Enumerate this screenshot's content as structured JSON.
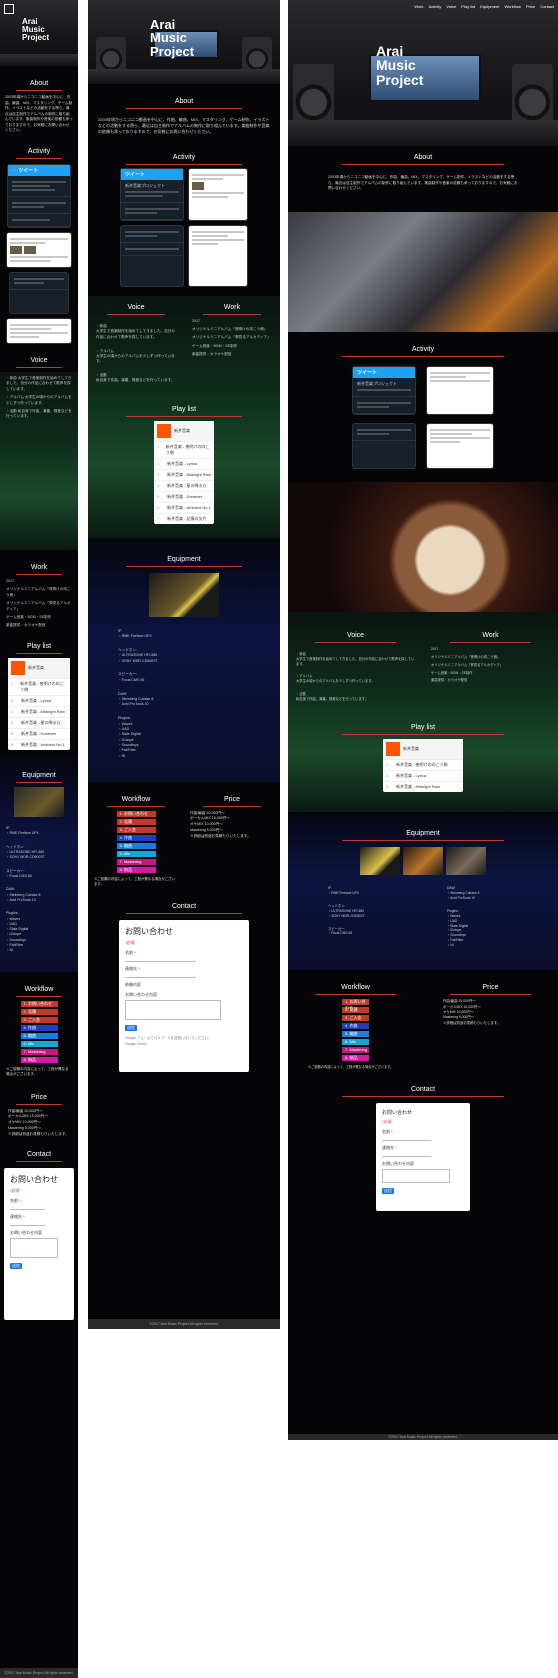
{
  "site": {
    "title_line1": "Arai",
    "title_line2": "Music",
    "title_line3": "Project",
    "nav": [
      "Work",
      "Activity",
      "Voice",
      "Play list",
      "Equipment",
      "Workflow",
      "Price",
      "Contact"
    ]
  },
  "sections": {
    "about": "About",
    "activity": "Activity",
    "voice": "Voice",
    "work": "Work",
    "playlist": "Play list",
    "equipment": "Equipment",
    "workflow": "Workflow",
    "price": "Price",
    "contact": "Contact"
  },
  "about_text": "2003年頃からニコニコ動画を中心に、作曲、編曲、MIX、マスタリング、ゲーム制作、イラストなどの活動をする傍ら、最近は自主制作でアルバムの制作に取り組んでいます。楽曲制作や音楽の依頼も承っておりますので、お気軽にお問い合わせください。",
  "activity": {
    "tweet_header": "ツイート",
    "tweet_user": "新井音楽プロジェクト",
    "tweet1": "新曲のデモを公開しました。今回はアンビエント寄りのトラックです。",
    "tweet2": "ミキシング作業中。週末には完成予定です。",
    "fb_title": "Arai Music Project"
  },
  "voice": [
    "・新曲\n大学生で音楽制作を始めてしてきました。自分の作品に合わせて歌声を探しています。",
    "・アルバム\n大学生の頃からのアルバムを少しずつ作っています。",
    "・活動\n私自身で作曲、演奏、録音などを行っています。"
  ],
  "work": [
    "2017",
    "オリジナルミニアルバム「夜明けの向こう側」",
    "オリジナルミニアルバム「夢見るアルカディア」",
    "ゲーム音楽・BGM・SE制作",
    "楽曲提供・カラオケ配信"
  ],
  "playlist": {
    "artist": "新井音楽",
    "title": "Arai Music Project",
    "tracks": [
      "新井音楽 - 夜明けの向こう側",
      "新井音楽 - Lyrica",
      "新井音楽 - Midnight Rain",
      "新井音楽 - 星の降る丘",
      "新井音楽 - Dreamer",
      "新井音楽 - Ambient No.1",
      "新井音楽 - 記憶の欠片",
      "新井音楽 - Arcadia"
    ],
    "footer": "Arai Music Project"
  },
  "equipment": [
    "IF:\n・RME Fireface UFX",
    "ヘッドホン:\n・ULTRASONE HFI-580\n・SONY MDR-CD900ST",
    "スピーカー:\n・Focal CMS 65",
    "DAW:\n・Steinberg Cubase 8\n・Avid ProTools 10",
    "Plugins:\n・Waves\n・UAD\n・Slate Digital\n・iZotope\n・Soundtoys\n・FabFilter\n・NI"
  ],
  "workflow": [
    {
      "label": "1. お問い合わせ",
      "color": "#c0392b"
    },
    {
      "label": "2. 見積",
      "color": "#c0392b"
    },
    {
      "label": "3. ご入金",
      "color": "#c0392b"
    },
    {
      "label": "4. 作曲",
      "color": "#1f3fbf"
    },
    {
      "label": "5. 編曲",
      "color": "#1a7fdb"
    },
    {
      "label": "6. Mix",
      "color": "#17a6d6"
    },
    {
      "label": "7. Mastering",
      "color": "#c3187f"
    },
    {
      "label": "8. 納品",
      "color": "#d11aa6"
    }
  ],
  "workflow_note": "※ご依頼の内容によって、工程が異なる場合がございます。",
  "price": [
    "作曲/編曲 20,000円〜",
    "ボーカルMIX 15,000円〜",
    "オケMIX 10,000円〜",
    "Mastering 5,000円〜",
    "※詳細は別途お見積もりいたします。"
  ],
  "contact": {
    "form_title": "お問い合わせ",
    "required_note": "*必須",
    "name_label": "名前 *",
    "name_placeholder": "回答を入力",
    "email_label": "連絡先 *",
    "email_placeholder": "回答を入力",
    "detail_label": "依頼内容",
    "message_label": "お問い合わせ内容",
    "submit": "送信",
    "notice": "Google フォームでパスワードを送信しないでください。",
    "powered": "Google Forms"
  },
  "footer": "©2017 Arai Music Project All rights reserved."
}
